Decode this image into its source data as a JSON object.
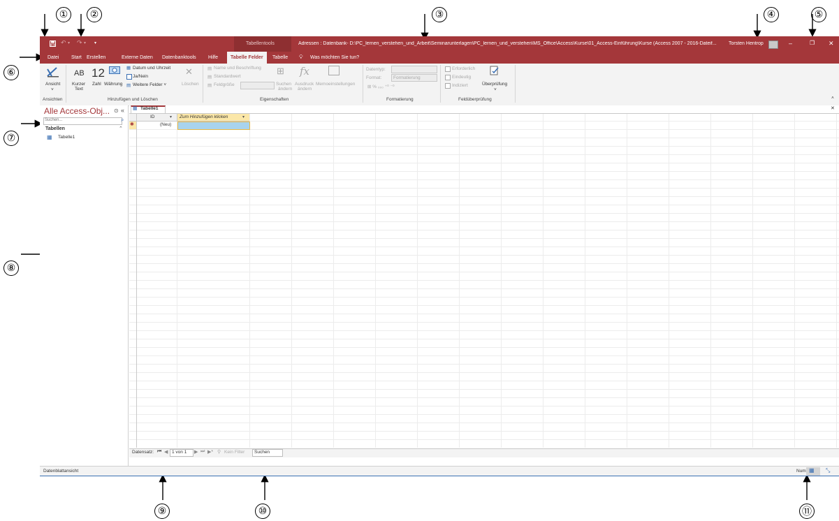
{
  "annotations": [
    "①",
    "②",
    "③",
    "④",
    "⑤",
    "⑥",
    "⑦",
    "⑧",
    "⑨",
    "⑩",
    "⑪"
  ],
  "titlebar": {
    "context_tab": "Tabellentools",
    "title": "Adressen : Datenbank- D:\\PC_lernen_verstehen_und_Arbeit\\Seminarunterlagen\\PC_lernen_und_verstehen\\MS_Office\\Access\\Kurse\\01_Access-Einführung\\Kurse (Access 2007 - 2016-Dateif...",
    "user": "Torsten Hentrop",
    "minimize": "–",
    "restore": "❐",
    "close": "✕",
    "qat_save_icon": "save-icon",
    "qat_dropdown": "▾"
  },
  "tabs": [
    "Datei",
    "Start",
    "Erstellen",
    "Externe Daten",
    "Datenbanktools",
    "Hilfe",
    "Tabelle Felder",
    "Tabelle",
    "Was möchten Sie tun?"
  ],
  "ribbon": {
    "ansicht": "Ansicht",
    "ansichten_group": "Ansichten",
    "kurzer_text_1": "Kurzer",
    "kurzer_text_2": "Text",
    "zahl": "Zahl",
    "waehrung": "Währung",
    "datum_uhrzeit": "Datum und Uhrzeit",
    "ja_nein": "Ja/Nein",
    "weitere_felder": "Weitere Felder ˅",
    "loeschen": "Löschen",
    "hinzufuegen_group": "Hinzufügen und Löschen",
    "name_beschriftung": "Name und Beschriftung",
    "standardwert": "Standardwert",
    "feldgroesse": "Feldgröße",
    "suchen_aendern_1": "Suchen",
    "suchen_aendern_2": "ändern",
    "ausdruck_aendern_1": "Ausdruck",
    "ausdruck_aendern_2": "ändern",
    "memoeinstellungen": "Memoeinstellungen",
    "eigenschaften_group": "Eigenschaften",
    "datentyp": "Datentyp:",
    "format": "Format:",
    "format_value": "Formatierung",
    "formatierung_group": "Formatierung",
    "erforderlich": "Erforderlich",
    "eindeutig": "Eindeutig",
    "indiziert": "Indiziert",
    "ueberpruefung": "Überprüfung",
    "feldueberpruefung_group": "Feldüberprüfung",
    "ab_icon": "AB",
    "twelve_icon": "12"
  },
  "navpane": {
    "title": "Alle Access-Obj...",
    "search_placeholder": "Suchen...",
    "section": "Tabellen",
    "items": [
      "Tabelle1"
    ]
  },
  "document": {
    "tab": "Tabelle1",
    "col_id": "ID",
    "col_add": "Zum Hinzufügen klicken",
    "new_row_marker": "✱",
    "new_row_value": "(Neu)",
    "record_label": "Datensatz:",
    "record_pos": "1 von 1",
    "filter": "Kein Filter",
    "search": "Suchen"
  },
  "status": {
    "view": "Datenblattansicht",
    "num": "Num"
  },
  "colors": {
    "accent": "#a4373a",
    "ribbon_bg": "#f3f3f3",
    "add_header": "#fbe7a8",
    "selected_cell": "#a8d3ee"
  }
}
